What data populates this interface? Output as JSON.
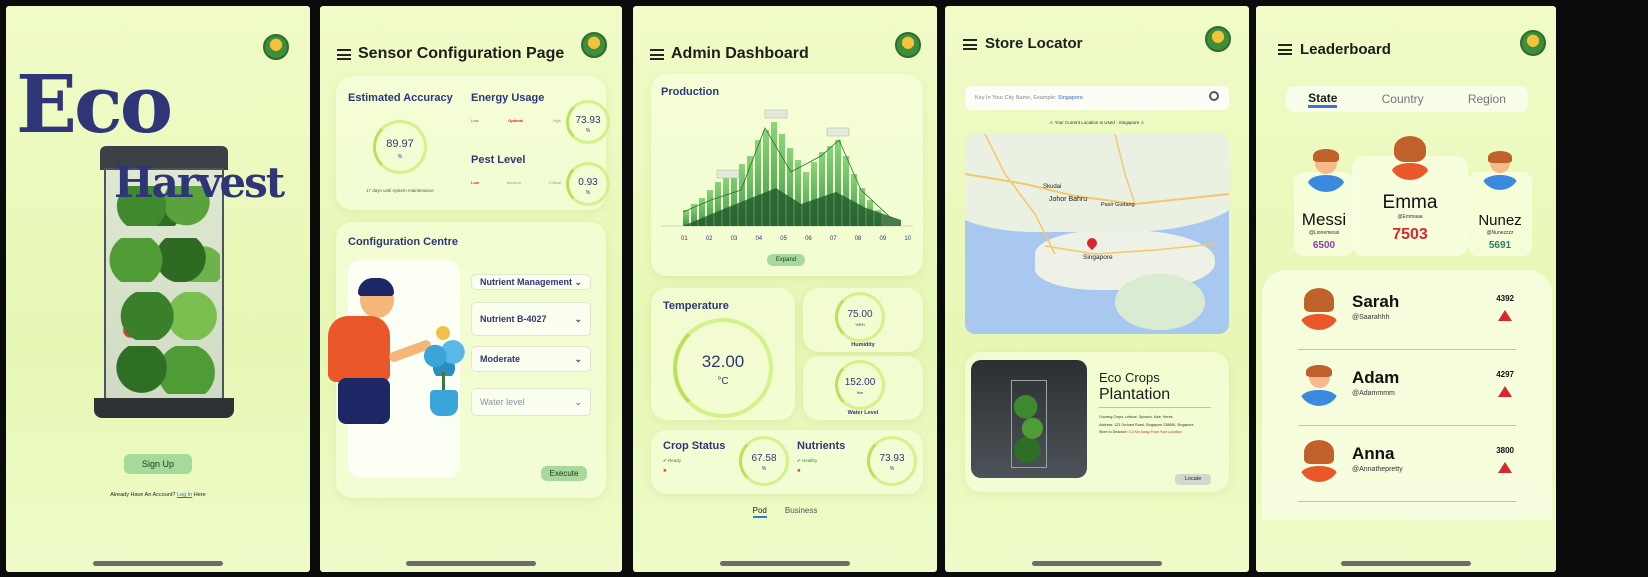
{
  "brand_logo_text": "ECOHARVEST",
  "screen1": {
    "title_line1": "Eco",
    "title_line2": "Harvest",
    "signup_label": "Sign Up",
    "already_text": "Already Have An Account?",
    "login_link": "Log In",
    "here_text": "Here"
  },
  "screen2": {
    "page_title": "Sensor Configuration Page",
    "accuracy": {
      "title": "Estimated Accuracy",
      "value": "89.97",
      "unit": "%",
      "note_num": "17",
      "note_text": "days until system maintenance"
    },
    "energy": {
      "title": "Energy Usage",
      "levels": [
        "Low",
        "Optimal",
        "High"
      ],
      "value": "73.93",
      "unit": "%"
    },
    "pest": {
      "title": "Pest Level",
      "levels": [
        "Low",
        "Medium",
        "Critical"
      ],
      "value": "0.93",
      "unit": "%"
    },
    "config": {
      "title": "Configuration Centre",
      "select1": "Nutrient Management",
      "select2": "Nutrient B-4027",
      "select3": "Moderate",
      "select4_placeholder": "Water level",
      "execute_label": "Execute"
    }
  },
  "screen3": {
    "page_title": "Admin Dashboard",
    "production": {
      "title": "Production",
      "x_ticks": [
        "01",
        "02",
        "03",
        "04",
        "05",
        "06",
        "07",
        "08",
        "09",
        "10"
      ],
      "expand_label": "Expand"
    },
    "temperature": {
      "title": "Temperature",
      "value": "32.00",
      "unit": "°C"
    },
    "humidity": {
      "value": "75.00",
      "unit": "%RH",
      "label": "Humidity"
    },
    "water_level": {
      "value": "152.00",
      "unit": "litre",
      "label": "Water Level"
    },
    "crop_status": {
      "title": "Crop Status",
      "ok": "Ready",
      "value": "67.58",
      "unit": "%"
    },
    "nutrients": {
      "title": "Nutrients",
      "ok": "Healthy",
      "value": "73.93",
      "unit": "%"
    },
    "tabs": [
      "Pod",
      "Business"
    ]
  },
  "screen4": {
    "page_title": "Store Locator",
    "search_hint": "Key In Your City Name, Example:",
    "search_example": "Singapore",
    "current_location": "Your Current Location Is Used - Singapore",
    "map_labels": [
      "Skudai",
      "Johor Bahru",
      "Pasir Gudang",
      "Singapore"
    ],
    "store_title_1": "Eco Crops",
    "store_title_2": "Plantation",
    "store_details": [
      {
        "k": "Growing Crops:",
        "v": "Lettuce, Spinach, Kale, Herbs"
      },
      {
        "k": "Address:",
        "v": "123 Orchard Road, Singapore 238858, Singapore"
      },
      {
        "k": "Store to Distance:",
        "v": "3.2 Km Away From Your Location"
      }
    ],
    "locate_label": "Locate"
  },
  "screen5": {
    "page_title": "Leaderboard",
    "tabs": [
      "State",
      "Country",
      "Region"
    ],
    "podium": [
      {
        "name": "Messi",
        "handle": "@Lionemessi",
        "score": "6500",
        "score_color": "#8a3fb8"
      },
      {
        "name": "Emma",
        "handle": "@Emmaaa",
        "score": "7503",
        "score_color": "#d9282b"
      },
      {
        "name": "Nunez",
        "handle": "@Nunezzzz",
        "score": "5691",
        "score_color": "#2b7d6a"
      }
    ],
    "rows": [
      {
        "name": "Sarah",
        "handle": "@Saarahhh",
        "score": "4392"
      },
      {
        "name": "Adam",
        "handle": "@Adammmm",
        "score": "4297"
      },
      {
        "name": "Anna",
        "handle": "@Annathepretty",
        "score": "3800"
      }
    ]
  }
}
